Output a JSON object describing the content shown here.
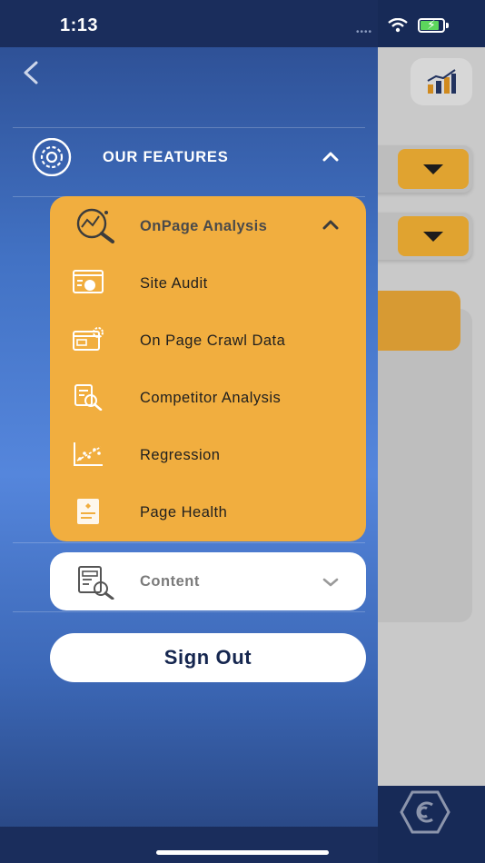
{
  "status_bar": {
    "time": "1:13"
  },
  "drawer": {
    "features_label": "OUR FEATURES",
    "onpage": {
      "label": "OnPage Analysis",
      "items": [
        {
          "label": "Site Audit",
          "icon": "site-audit-icon"
        },
        {
          "label": "On Page Crawl Data",
          "icon": "crawl-data-icon"
        },
        {
          "label": "Competitor Analysis",
          "icon": "competitor-analysis-icon"
        },
        {
          "label": "Regression",
          "icon": "regression-icon"
        },
        {
          "label": "Page Health",
          "icon": "page-health-icon"
        }
      ]
    },
    "content_label": "Content",
    "sign_out_label": "Sign Out"
  },
  "colors": {
    "drawer_gradient_top": "#2a4a8d",
    "drawer_gradient_mid": "#5586dc",
    "accent_gold": "#f1ae3f",
    "navy": "#15264f",
    "white": "#ffffff"
  }
}
